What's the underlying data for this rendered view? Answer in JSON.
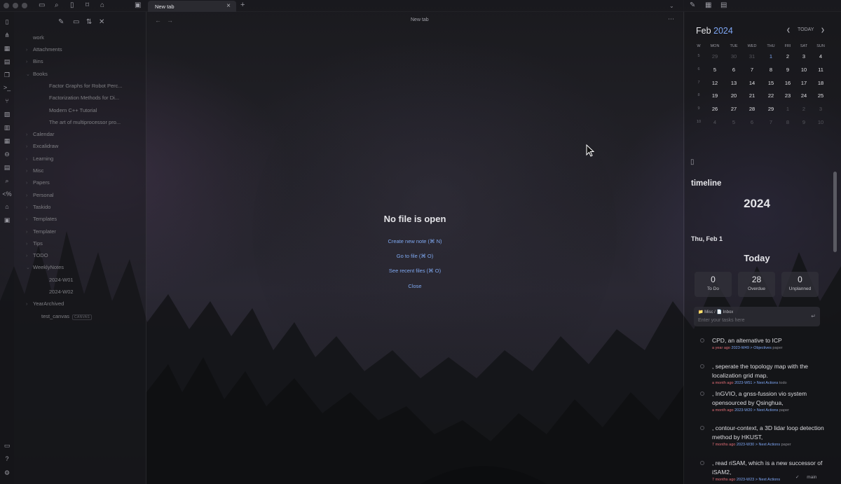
{
  "ribbon": {
    "icons": [
      "file-icon",
      "graph-icon",
      "canvas-icon",
      "calendar-icon",
      "copy-icon",
      "terminal-icon",
      "git-icon",
      "image-icon",
      "layout-icon",
      "table-icon",
      "pin-icon",
      "calendar-alt-icon",
      "search-icon",
      "code-icon",
      "home-icon",
      "calendar-day-icon"
    ],
    "bottom_icons": [
      "vault-icon",
      "help-icon",
      "settings-icon"
    ]
  },
  "top_bar": {
    "tab": {
      "label": "New tab"
    },
    "new_tab": "+",
    "close": "×"
  },
  "file_explorer": {
    "root": "work",
    "items": [
      {
        "label": "Attachments",
        "type": "folder",
        "depth": 1
      },
      {
        "label": "Bins",
        "type": "folder",
        "depth": 1
      },
      {
        "label": "Books",
        "type": "folder-open",
        "depth": 1
      },
      {
        "label": "Factor Graphs for Robot Perc...",
        "type": "file",
        "depth": 2
      },
      {
        "label": "Factorization Methods for Di...",
        "type": "file",
        "depth": 2
      },
      {
        "label": "Modern C++ Tutorial",
        "type": "file",
        "depth": 2
      },
      {
        "label": "The art of multiprocessor pro...",
        "type": "file",
        "depth": 2
      },
      {
        "label": "Calendar",
        "type": "folder",
        "depth": 1
      },
      {
        "label": "Excalidraw",
        "type": "folder",
        "depth": 1
      },
      {
        "label": "Learning",
        "type": "folder",
        "depth": 1
      },
      {
        "label": "Misc",
        "type": "folder",
        "depth": 1
      },
      {
        "label": "Papers",
        "type": "folder",
        "depth": 1
      },
      {
        "label": "Personal",
        "type": "folder",
        "depth": 1
      },
      {
        "label": "Taskido",
        "type": "folder",
        "depth": 1
      },
      {
        "label": "Templates",
        "type": "folder",
        "depth": 1
      },
      {
        "label": "Templater",
        "type": "folder",
        "depth": 1
      },
      {
        "label": "Tips",
        "type": "folder",
        "depth": 1
      },
      {
        "label": "TODO",
        "type": "folder",
        "depth": 1
      },
      {
        "label": "WeeklyNotes",
        "type": "folder-open",
        "depth": 1
      },
      {
        "label": "2024-W01",
        "type": "file",
        "depth": 2
      },
      {
        "label": "2024-W02",
        "type": "file",
        "depth": 2
      },
      {
        "label": "YearArchived",
        "type": "folder",
        "depth": 1
      },
      {
        "label": "test_canvas",
        "type": "canvas",
        "depth": 1
      }
    ],
    "canvas_tag": "CANVAS"
  },
  "center": {
    "title": "New tab",
    "heading": "No file is open",
    "actions": [
      "Create new note (⌘ N)",
      "Go to file (⌘ O)",
      "See recent files (⌘ O)",
      "Close"
    ]
  },
  "calendar": {
    "month": "Feb",
    "year": "2024",
    "today_btn": "TODAY",
    "weekdays": [
      "W",
      "MON",
      "TUE",
      "WED",
      "THU",
      "FRI",
      "SAT",
      "SUN"
    ],
    "weeks": [
      {
        "w": "5",
        "days": [
          "29",
          "30",
          "31",
          "1",
          "2",
          "3",
          "4"
        ]
      },
      {
        "w": "6",
        "days": [
          "5",
          "6",
          "7",
          "8",
          "9",
          "10",
          "11"
        ]
      },
      {
        "w": "7",
        "days": [
          "12",
          "13",
          "14",
          "15",
          "16",
          "17",
          "18"
        ]
      },
      {
        "w": "8",
        "days": [
          "19",
          "20",
          "21",
          "22",
          "23",
          "24",
          "25"
        ]
      },
      {
        "w": "9",
        "days": [
          "26",
          "27",
          "28",
          "29",
          "1",
          "2",
          "3"
        ]
      },
      {
        "w": "10",
        "days": [
          "4",
          "5",
          "6",
          "7",
          "8",
          "9",
          "10"
        ]
      }
    ]
  },
  "timeline": {
    "label": "timeline",
    "year": "2024",
    "date": "Thu, Feb 1",
    "today": "Today",
    "stats": [
      {
        "n": "0",
        "label": "To Do"
      },
      {
        "n": "28",
        "label": "Overdue"
      },
      {
        "n": "0",
        "label": "Unplanned"
      }
    ],
    "inbox": {
      "crumb": "📁 Misc  /  📄 Inbox",
      "placeholder": "Enter your tasks here"
    },
    "tasks": [
      {
        "title": "CPD, an alternative to ICP",
        "due": "a year ago",
        "meta": "2023-W49 > Objectives",
        "tag": "paper"
      },
      {
        "title": ", seperate the topology map with the localization grid map.",
        "due": "a month ago",
        "meta": "2023-W51 > Next Actions",
        "tag": "todo"
      },
      {
        "title": ", InGVIO, a gnss-fussion vio system opensourced by Qsinghua,",
        "due": "a month ago",
        "meta": "2023-W20 > Next Actions",
        "tag": "paper"
      },
      {
        "title": ", contour-context, a 3D lidar loop detection method by HKUST,",
        "due": "7 months ago",
        "meta": "2023-W30 > Next Actions",
        "tag": "paper"
      },
      {
        "title": ", read riSAM, which is a new successor of iSAM2,",
        "due": "7 months ago",
        "meta": "2023-W23 > Next Actions",
        "tag": ""
      }
    ]
  },
  "status_bar": {
    "branch": "main",
    "check": "✓"
  }
}
